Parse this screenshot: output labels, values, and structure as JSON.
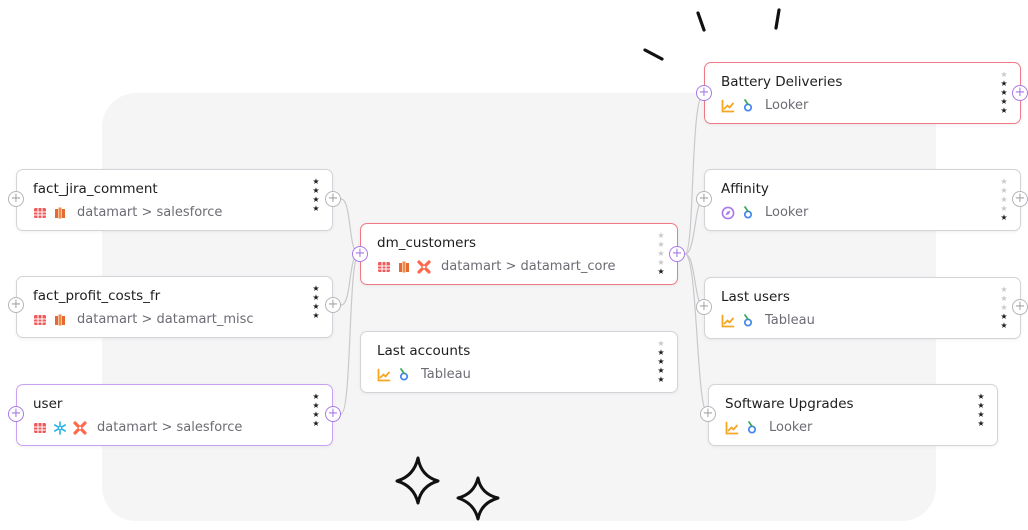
{
  "nodes": {
    "fact_jira_comment": {
      "title": "fact_jira_comment",
      "path": "datamart > salesforce",
      "stars_on": 4,
      "icons": [
        "table-icon",
        "redshift-icon"
      ]
    },
    "fact_profit_costs_fr": {
      "title": "fact_profit_costs_fr",
      "path": "datamart > datamart_misc",
      "stars_on": 4,
      "icons": [
        "table-icon",
        "redshift-icon"
      ]
    },
    "user": {
      "title": "user",
      "path": "datamart > salesforce",
      "stars_on": 4,
      "icons": [
        "table-icon",
        "snowflake-icon",
        "dbt-icon"
      ]
    },
    "dm_customers": {
      "title": "dm_customers",
      "path": "datamart > datamart_core",
      "stars_on": 1,
      "icons": [
        "table-icon",
        "redshift-icon",
        "dbt-icon"
      ]
    },
    "last_accounts": {
      "title": "Last accounts",
      "path": "Tableau",
      "stars_on": 4,
      "icons": [
        "chart-icon",
        "tableau-icon"
      ]
    },
    "battery_deliveries": {
      "title": "Battery Deliveries",
      "path": "Looker",
      "stars_on": 4,
      "icons": [
        "chart-icon",
        "looker-icon"
      ]
    },
    "affinity": {
      "title": "Affinity",
      "path": "Looker",
      "stars_on": 1,
      "icons": [
        "compass-icon",
        "looker-icon"
      ]
    },
    "last_users": {
      "title": "Last users",
      "path": "Tableau",
      "stars_on": 2,
      "icons": [
        "chart-icon",
        "tableau-icon"
      ]
    },
    "software_upgrades": {
      "title": "Software Upgrades",
      "path": "Looker",
      "stars_on": 4,
      "icons": [
        "chart-icon",
        "looker-icon"
      ]
    }
  },
  "ports": {
    "plus": "+"
  },
  "colors": {
    "selected_border": "#ef7a86",
    "highlight_border": "#c9a2f2",
    "port_accent": "#a978e8",
    "table_icon": "#ef5b5b",
    "redshift_icon": "#f08a4b",
    "dbt_icon": "#ff694b",
    "snowflake_icon": "#29b5e8",
    "chart_icon": "#f5a623",
    "looker_icon": "#4285f4",
    "compass_icon": "#a978e8"
  }
}
